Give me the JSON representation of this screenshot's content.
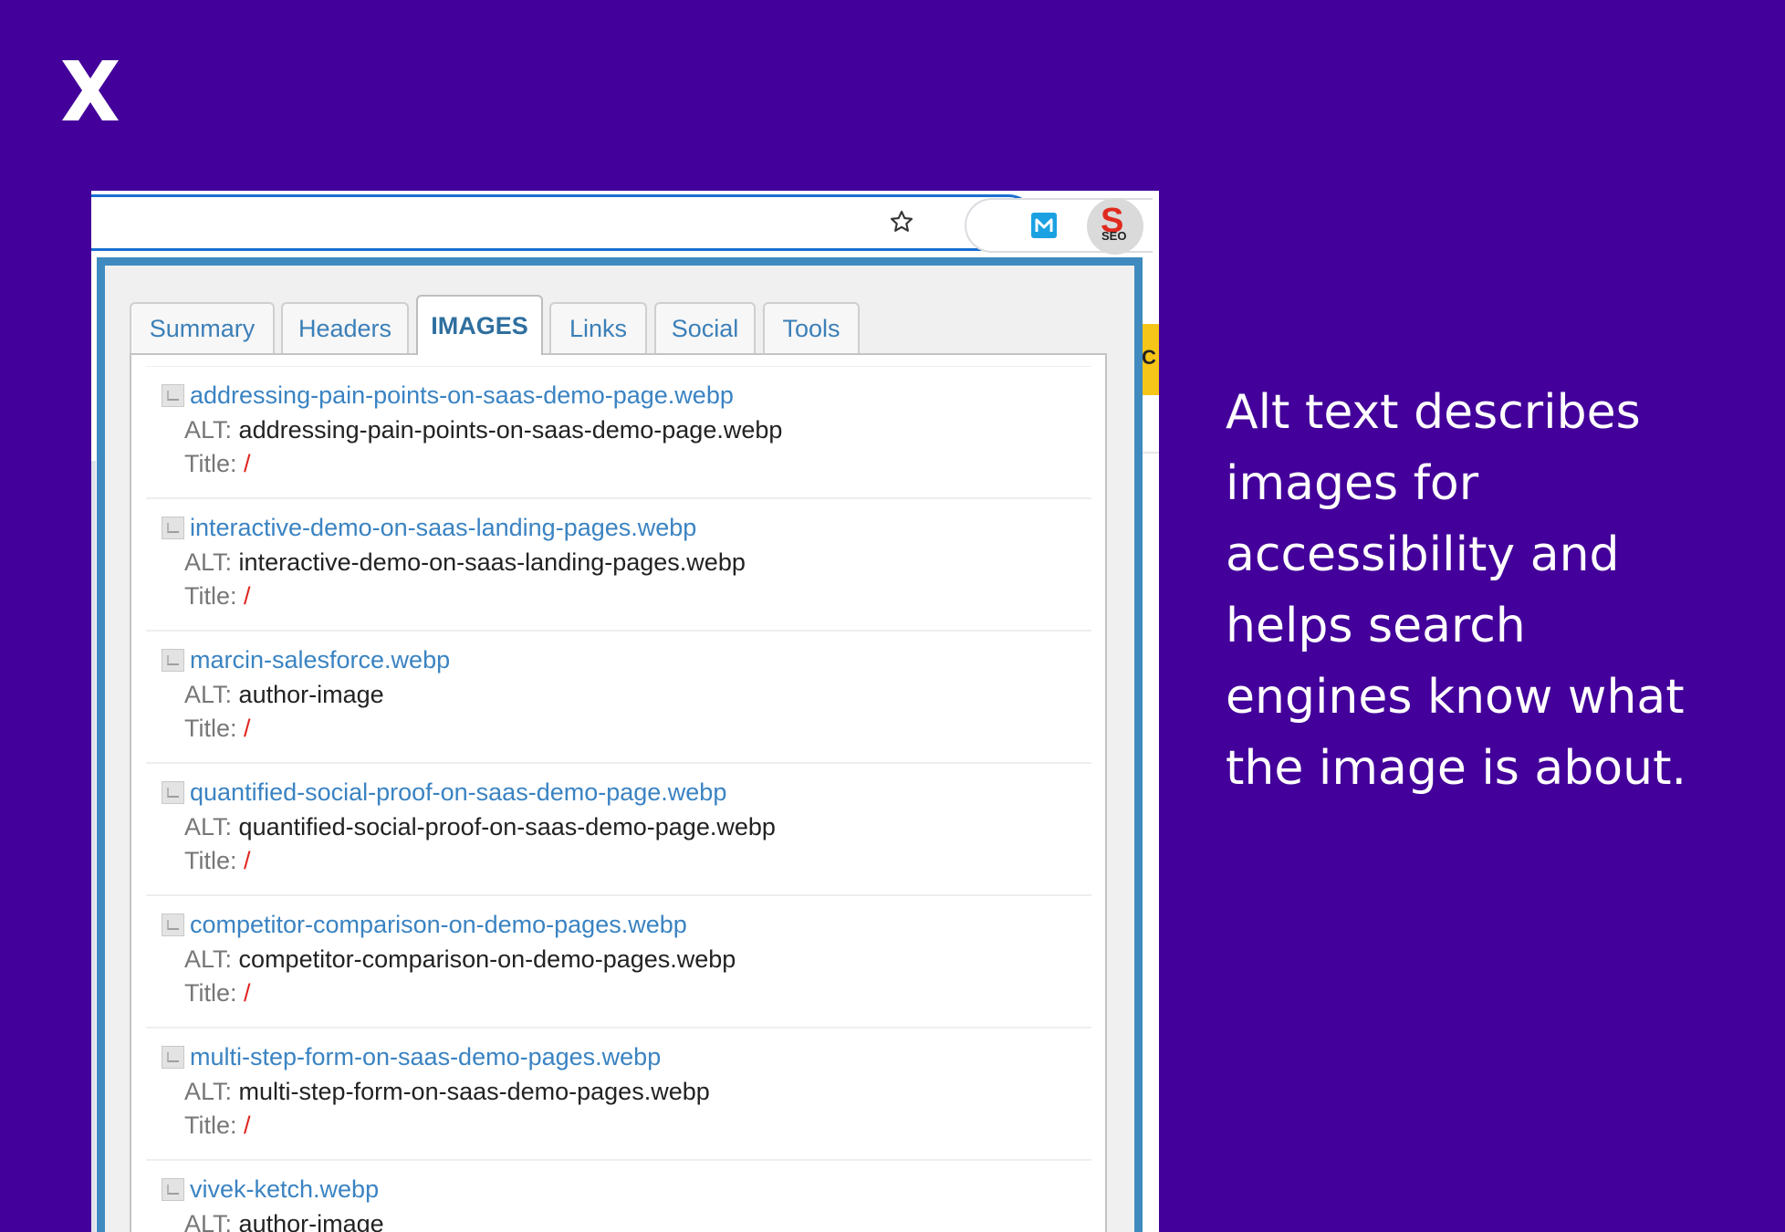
{
  "brand": {
    "logo_icon": "x-logo-icon"
  },
  "browser": {
    "star_icon": "star-outline-icon",
    "extensions": [
      {
        "name": "m-extension-icon",
        "color": "#1ba1e2"
      },
      {
        "name": "refresh-c-extension-icon",
        "color": "#7a7a7a"
      },
      {
        "name": "seo-extension-icon",
        "letter": "S",
        "text": "SEO"
      }
    ],
    "background_page": {
      "sliver_text": "C"
    }
  },
  "popup": {
    "tabs": [
      {
        "label": "Summary",
        "active": false
      },
      {
        "label": "Headers",
        "active": false
      },
      {
        "label": "IMAGES",
        "active": true
      },
      {
        "label": "Links",
        "active": false
      },
      {
        "label": "Social",
        "active": false
      },
      {
        "label": "Tools",
        "active": false
      }
    ],
    "alt_label": "ALT:",
    "title_label": "Title:",
    "images": [
      {
        "file": "addressing-pain-points-on-saas-demo-page.webp",
        "alt": "addressing-pain-points-on-saas-demo-page.webp",
        "title": "/"
      },
      {
        "file": "interactive-demo-on-saas-landing-pages.webp",
        "alt": "interactive-demo-on-saas-landing-pages.webp",
        "title": "/"
      },
      {
        "file": "marcin-salesforce.webp",
        "alt": "author-image",
        "title": "/"
      },
      {
        "file": "quantified-social-proof-on-saas-demo-page.webp",
        "alt": "quantified-social-proof-on-saas-demo-page.webp",
        "title": "/"
      },
      {
        "file": "competitor-comparison-on-demo-pages.webp",
        "alt": "competitor-comparison-on-demo-pages.webp",
        "title": "/"
      },
      {
        "file": "multi-step-form-on-saas-demo-pages.webp",
        "alt": "multi-step-form-on-saas-demo-pages.webp",
        "title": "/"
      },
      {
        "file": "vivek-ketch.webp",
        "alt": "author-image",
        "title": "/"
      }
    ]
  },
  "caption": {
    "lines": [
      "Alt text describes",
      "images for",
      "accessibility and",
      "helps search",
      "engines know what",
      "the image is about."
    ]
  },
  "colors": {
    "background": "#43009a",
    "popup_border": "#3f8bbf",
    "link": "#3a83c2",
    "title_slash": "#e0241f"
  }
}
